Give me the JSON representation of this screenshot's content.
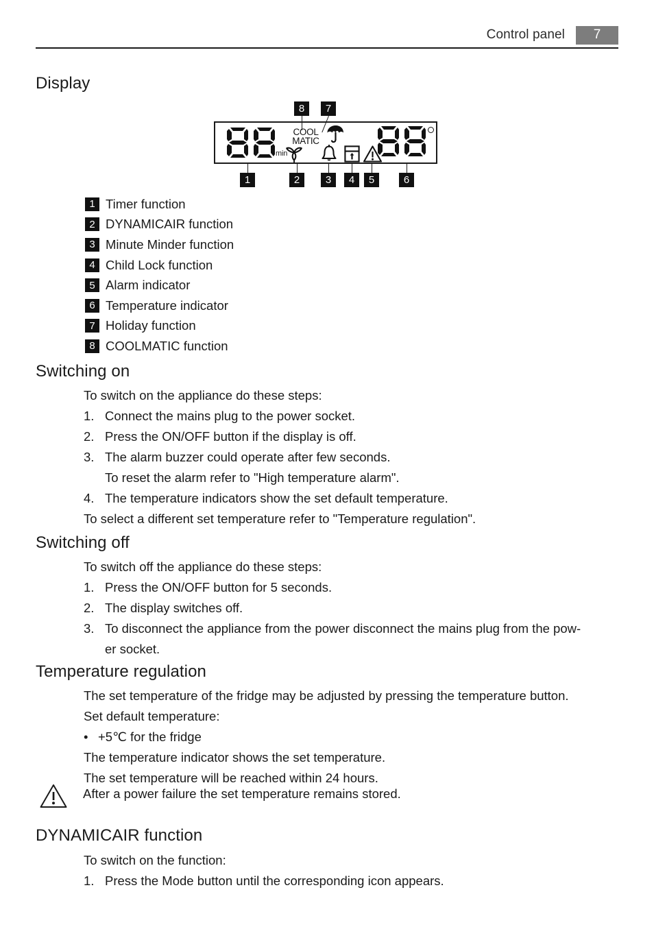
{
  "header": {
    "title": "Control panel",
    "page_number": "7",
    "badge_color": "#7d7d7d"
  },
  "sections": {
    "display": {
      "heading": "Display"
    },
    "switching_on": {
      "heading": "Switching on",
      "intro": "To switch on the appliance do these steps:",
      "steps": [
        {
          "num": "1.",
          "text": "Connect the mains plug to the power socket."
        },
        {
          "num": "2.",
          "text": "Press the ON/OFF button if the display is off."
        },
        {
          "num": "3.",
          "text": "The alarm buzzer could operate after few seconds."
        }
      ],
      "continuation": "To reset the alarm refer to \"High temperature alarm\".",
      "step4": {
        "num": "4.",
        "text": "The temperature indicators show the set default temperature."
      },
      "closing": "To select a different set temperature refer to \"Temperature regulation\"."
    },
    "switching_off": {
      "heading": "Switching off",
      "intro": "To switch off the appliance do these steps:",
      "steps": [
        {
          "num": "1.",
          "text": "Press the ON/OFF button for 5 seconds."
        },
        {
          "num": "2.",
          "text": "The display switches off."
        },
        {
          "num": "3.",
          "text": "To disconnect the appliance from the power disconnect the mains plug from the pow-"
        }
      ],
      "step3_wrap": "er socket."
    },
    "temperature_regulation": {
      "heading": "Temperature regulation",
      "line1": "The set temperature of the fridge may be adjusted by pressing the temperature button.",
      "line2": "Set default temperature:",
      "bullet": "+5℃ for the fridge",
      "line3": "The temperature indicator shows the set temperature.",
      "line4": "The set temperature will be reached within 24 hours."
    },
    "note": {
      "icon": "warning-triangle-icon",
      "text": "After a power failure the set temperature remains stored."
    },
    "dynamicair": {
      "heading": "DYNAMICAIR function",
      "intro": "To switch on the function:",
      "steps": [
        {
          "num": "1.",
          "text": "Press the Mode button until the corresponding icon appears."
        }
      ]
    }
  },
  "diagram": {
    "timer_digits": "88",
    "timer_unit": "min",
    "coolmatic_line1": "COOL",
    "coolmatic_line2": "MATIC",
    "temp_digits": "88",
    "degree_symbol": "°",
    "icons": {
      "holiday": "umbrella-icon",
      "dynamicair": "fan-icon",
      "minute_minder": "bell-icon",
      "child_lock": "child-lock-icon",
      "alarm": "warning-triangle-icon"
    },
    "callouts": [
      {
        "id": "1",
        "label": "1"
      },
      {
        "id": "2",
        "label": "2"
      },
      {
        "id": "3",
        "label": "3"
      },
      {
        "id": "4",
        "label": "4"
      },
      {
        "id": "5",
        "label": "5"
      },
      {
        "id": "6",
        "label": "6"
      },
      {
        "id": "7",
        "label": "7"
      },
      {
        "id": "8",
        "label": "8"
      }
    ]
  },
  "legend": [
    {
      "num": "1",
      "label": "Timer function"
    },
    {
      "num": "2",
      "label": "DYNAMICAIR function"
    },
    {
      "num": "3",
      "label": "Minute Minder function"
    },
    {
      "num": "4",
      "label": "Child Lock function"
    },
    {
      "num": "5",
      "label": "Alarm indicator"
    },
    {
      "num": "6",
      "label": "Temperature indicator"
    },
    {
      "num": "7",
      "label": "Holiday function"
    },
    {
      "num": "8",
      "label": "COOLMATIC function"
    }
  ]
}
